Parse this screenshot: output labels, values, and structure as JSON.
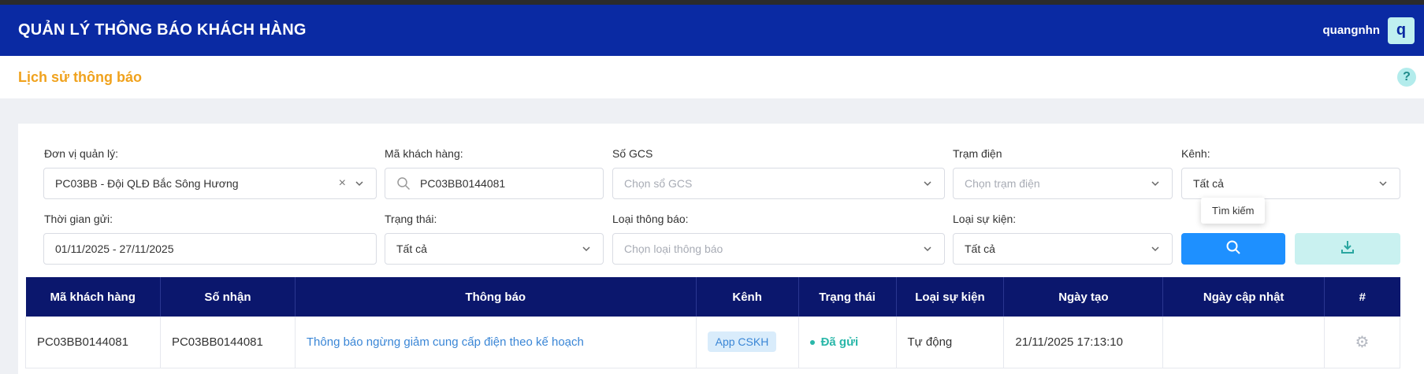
{
  "header": {
    "title": "QUẢN LÝ THÔNG BÁO KHÁCH HÀNG",
    "username": "quangnhn",
    "avatar_letter": "q"
  },
  "page": {
    "title": "Lịch sử thông báo"
  },
  "filters": {
    "don_vi": {
      "label": "Đơn vị quản lý:",
      "value": "PC03BB - Đội QLĐ Bắc Sông Hương"
    },
    "ma_kh": {
      "label": "Mã khách hàng:",
      "value": "PC03BB0144081"
    },
    "so_gcs": {
      "label": "Số GCS",
      "placeholder": "Chọn sổ GCS"
    },
    "tram_dien": {
      "label": "Trạm điện",
      "placeholder": "Chọn trạm điện"
    },
    "kenh": {
      "label": "Kênh:",
      "value": "Tất cả"
    },
    "thoi_gian": {
      "label": "Thời gian gửi:",
      "value": "01/11/2025 - 27/11/2025"
    },
    "trang_thai": {
      "label": "Trạng thái:",
      "value": "Tất cả"
    },
    "loai_tb": {
      "label": "Loại thông báo:",
      "placeholder": "Chọn loại thông báo"
    },
    "loai_su_kien": {
      "label": "Loại sự kiện:",
      "value": "Tất cả"
    }
  },
  "tooltip": "Tìm kiếm",
  "table": {
    "headers": [
      "Mã khách hàng",
      "Số nhận",
      "Thông báo",
      "Kênh",
      "Trạng thái",
      "Loại sự kiện",
      "Ngày tạo",
      "Ngày cập nhật",
      "#"
    ],
    "rows": [
      {
        "ma_kh": "PC03BB0144081",
        "so_nhan": "PC03BB0144081",
        "thong_bao": "Thông báo ngừng giảm cung cấp điện theo kế hoạch",
        "kenh": "App CSKH",
        "trang_thai": "Đã gửi",
        "loai_su_kien": "Tự động",
        "ngay_tao": "21/11/2025 17:13:10",
        "ngay_cap_nhat": ""
      }
    ]
  },
  "colors": {
    "header_bg": "#0a2aa3",
    "table_header_bg": "#0b176d",
    "accent_title": "#f0a21d",
    "search_button": "#1e90ff",
    "export_button": "#c9f1f0",
    "status_sent": "#2ab7a9"
  },
  "icons": {
    "clear": "close-icon",
    "dropdown": "chevron-down-icon",
    "search": "search-icon",
    "export": "download-icon",
    "row_action": "gear-icon",
    "help": "help-icon"
  }
}
